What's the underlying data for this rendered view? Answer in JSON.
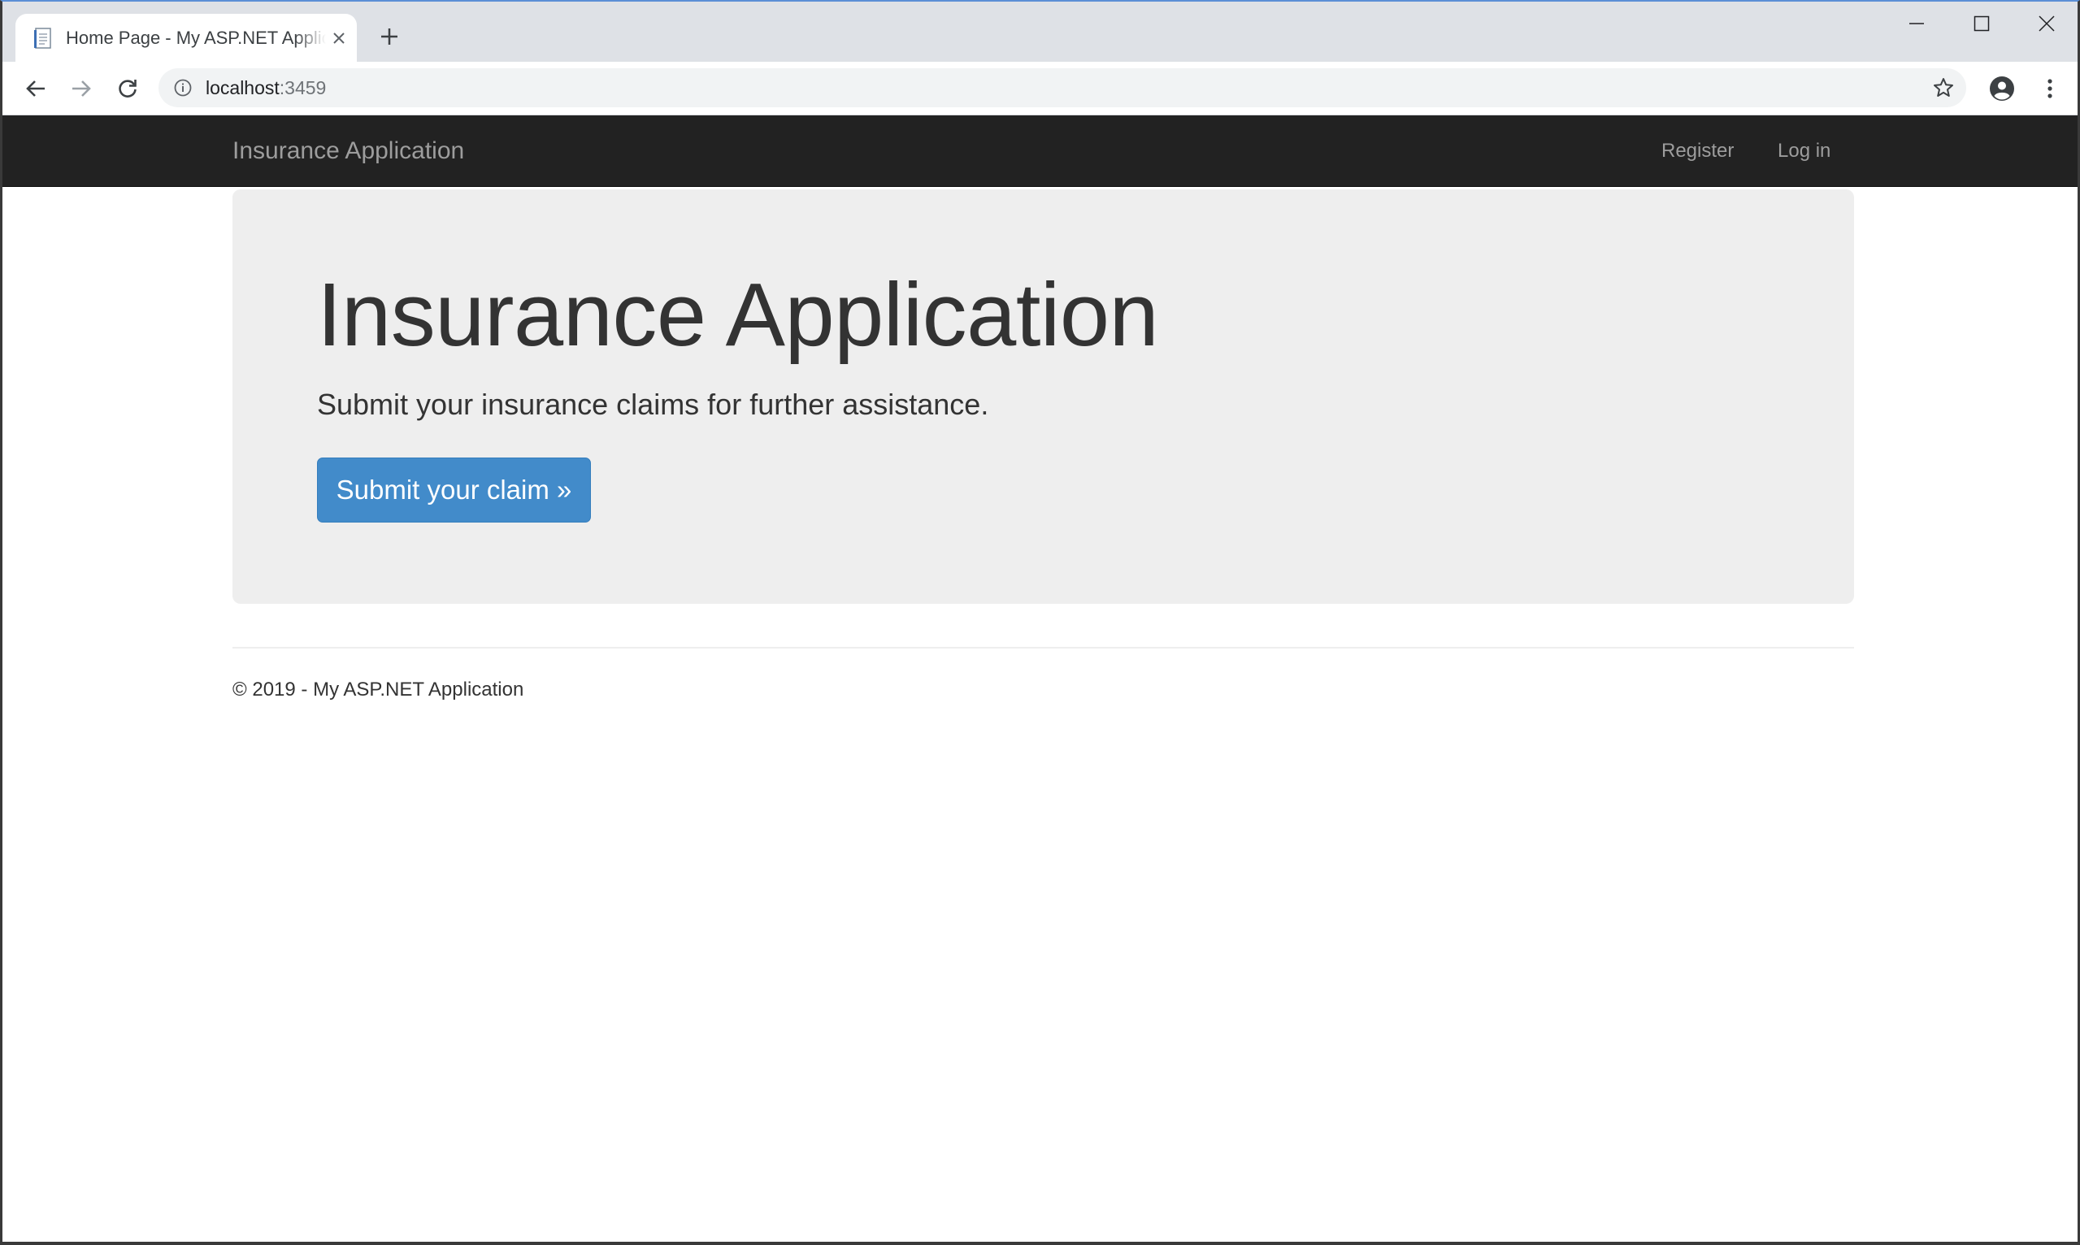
{
  "browser": {
    "tab": {
      "title": "Home Page - My ASP.NET Application",
      "favicon": "document-icon"
    },
    "new_tab_icon": "plus-icon",
    "window_controls": [
      "minimize-icon",
      "maximize-icon",
      "close-icon"
    ],
    "toolbar": {
      "back_icon": "arrow-left-icon",
      "forward_icon": "arrow-right-icon",
      "reload_icon": "reload-icon",
      "address": {
        "host": "localhost",
        "port": ":3459",
        "info_icon": "info-icon",
        "bookmark_icon": "star-icon"
      },
      "profile_icon": "account-circle-icon",
      "menu_icon": "kebab-menu-icon"
    }
  },
  "site": {
    "navbar": {
      "brand": "Insurance Application",
      "links": [
        "Register",
        "Log in"
      ]
    },
    "jumbotron": {
      "title": "Insurance Application",
      "lead": "Submit your insurance claims for further assistance.",
      "button_label": "Submit your claim »"
    },
    "footer": {
      "text": "© 2019 - My ASP.NET Application"
    }
  },
  "colors": {
    "tabstrip_bg": "#dee1e6",
    "navbar_bg": "#222222",
    "navbar_text": "#9d9d9d",
    "jumbotron_bg": "#eeeeee",
    "primary_button": "#428bca",
    "text": "#333333"
  }
}
